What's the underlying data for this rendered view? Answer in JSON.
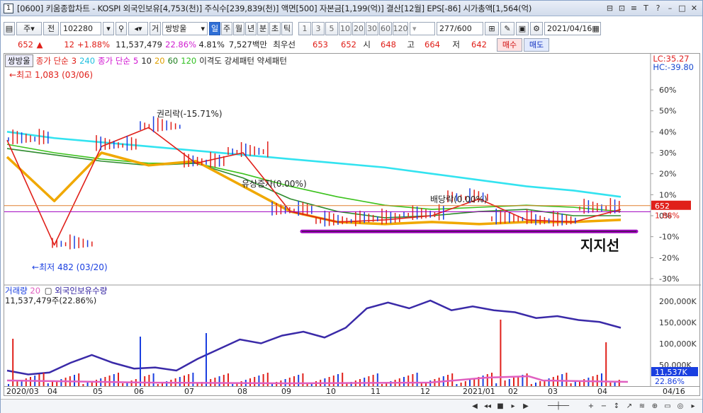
{
  "window": {
    "number": "1",
    "title": "[0600] 키움종합차트 - KOSPI 외국인보유[4,753(천)] 주식수[239,839(천)] 액면[500] 자본금[1,199(억)] 결산[12월] EPS[-86] 시가총액[1,564(억)"
  },
  "toolbar": {
    "market_type": "주",
    "period_btn": "전",
    "code": "102280",
    "stock_type_btn": "거",
    "stock_name": "쌍방울",
    "periods": [
      "일",
      "주",
      "월",
      "년",
      "분",
      "초",
      "틱"
    ],
    "selected_period": "일",
    "intervals": [
      "1",
      "3",
      "5",
      "10",
      "20",
      "30",
      "60",
      "120"
    ],
    "count": "277",
    "count_max": "/600",
    "date": "2021/04/16"
  },
  "price_row": {
    "price": "652",
    "change_arrow": "▲",
    "change": "12",
    "change_pct": "+1.88%",
    "volume": "11,537,479",
    "volume_ratio": "22.86%",
    "turnover_pct": "4.81%",
    "amount": "7,527백만",
    "best_label": "최우선",
    "best_ask": "653",
    "best_bid": "652",
    "open_label": "시",
    "open": "648",
    "high_label": "고",
    "high": "664",
    "low_label": "저",
    "low": "642",
    "buy_label": "매수",
    "sell_label": "매도"
  },
  "chart_data": {
    "type": "line",
    "title": "쌍방울",
    "legend": {
      "stock": "쌍방울",
      "ma_group1_label": "종가 단순",
      "ma_group1_values": [
        "3",
        "240"
      ],
      "ma_group2_label": "종가 단순",
      "ma_group2_values": [
        "5",
        "10",
        "20",
        "60",
        "120"
      ],
      "extra": "이격도 강세패턴 약세패턴"
    },
    "lc": "LC:35.27",
    "hc": "HC:-39.80",
    "x_labels": [
      "2020/03",
      "04",
      "05",
      "06",
      "07",
      "08",
      "09",
      "10",
      "11",
      "12",
      "2021/01",
      "02",
      "03",
      "04",
      "04/16"
    ],
    "y_pct_labels": [
      "60%",
      "50%",
      "40%",
      "30%",
      "20%",
      "10%",
      "0%",
      "-10%",
      "-20%",
      "-30%"
    ],
    "current_price_tag": "652",
    "current_pct_tag": "1.88%",
    "annotations": {
      "high": "최고 1,083 (03/06)",
      "low": "최저 482 (03/20)",
      "rights": "권리락(-15.71%)",
      "capital_increase": "유상증자(0.00%)",
      "dividend": "배당락(0.00%)",
      "support": "지지선"
    },
    "series": [
      {
        "name": "ma240",
        "color": "#33e3f0",
        "values": [
          40,
          37,
          35,
          33,
          31,
          29,
          27,
          25,
          23,
          20,
          17,
          14,
          12,
          9
        ]
      },
      {
        "name": "ma120",
        "color": "#3cc21d",
        "values": [
          34,
          30,
          27,
          25,
          25,
          20,
          14,
          9,
          5,
          3,
          4,
          5,
          4,
          2
        ]
      },
      {
        "name": "ma60",
        "color": "#2e8b2e",
        "values": [
          32,
          29,
          26,
          24,
          25,
          18,
          8,
          2,
          -1,
          0,
          2,
          3,
          0,
          0
        ]
      },
      {
        "name": "ma20",
        "color": "#f0a800",
        "values": [
          28,
          7,
          30,
          24,
          26,
          14,
          2,
          -3,
          -4,
          -3,
          -4,
          -3,
          -3,
          -2
        ]
      },
      {
        "name": "price",
        "color": "#e0201a",
        "values": [
          36,
          -14,
          33,
          42,
          25,
          30,
          2,
          -3,
          -2,
          0,
          8,
          -2,
          -3,
          3
        ]
      }
    ],
    "volume_panel": {
      "legend_label": "거래량",
      "legend_value": "20",
      "foreign_label": "외국인보유수량",
      "volume_value": "11,537,479주(22.86%)",
      "y_labels": [
        "200,000K",
        "150,000K",
        "100,000K",
        "50,000K"
      ],
      "current_tag": "11,537K",
      "current_pct": "22.86%"
    }
  },
  "colors": {
    "accent": "#2f6fd6",
    "up": "#e0201a",
    "down": "#1a3fe0",
    "support": "#a000c0"
  }
}
